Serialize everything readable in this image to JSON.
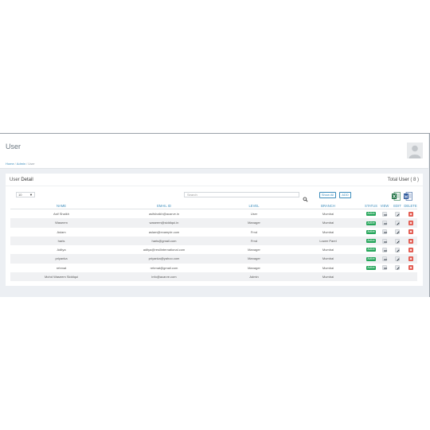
{
  "header": {
    "title": "User"
  },
  "breadcrumb": [
    "Home",
    "Admin",
    "User"
  ],
  "card": {
    "title_prefix": "User",
    "title_bold": "Detail",
    "total_prefix": "Total",
    "total_bold": "User",
    "total_count": "( 8 )"
  },
  "controls": {
    "page_size": "10",
    "search_placeholder": "Search",
    "show_all_label": "Show All",
    "add_label": "ADD"
  },
  "table": {
    "columns": [
      "NAME",
      "EMAIL ID",
      "LEVEL",
      "BRANCH",
      "STATUS",
      "VIEW",
      "EDIT",
      "DELETE"
    ],
    "rows": [
      {
        "name": "Asif Shaikh",
        "email": "asifshaikh@acarve.in",
        "level": "User",
        "branch": "Mumbai",
        "status": "Active",
        "actions": true
      },
      {
        "name": "Waseem",
        "email": "waseem@siddiqui.in",
        "level": "Manager",
        "branch": "Mumbai",
        "status": "Active",
        "actions": true
      },
      {
        "name": "Aslam",
        "email": "aslam@example.com",
        "level": "Frnd",
        "branch": "Mumbai",
        "status": "Active",
        "actions": true
      },
      {
        "name": "haris",
        "email": "haris@gmail.com",
        "level": "Frnd",
        "branch": "Lower Parel",
        "status": "Active",
        "actions": true
      },
      {
        "name": "Aditya",
        "email": "aditya@resilinternational.com",
        "level": "Manager",
        "branch": "Mumbai",
        "status": "Active",
        "actions": true
      },
      {
        "name": "priyanka",
        "email": "priyanka@yahoo.com",
        "level": "Manager",
        "branch": "Mumbai",
        "status": "Active",
        "actions": true
      },
      {
        "name": "rehmat",
        "email": "rehmat@gmail.com",
        "level": "Manager",
        "branch": "Mumbai",
        "status": "Active",
        "actions": true
      },
      {
        "name": "Mohd Waseem Siddiqui",
        "email": "info@acarve.com",
        "level": "Admin",
        "branch": "Mumbai",
        "status": "",
        "actions": false
      }
    ]
  },
  "icons": {
    "avatar": "user-avatar-icon",
    "search": "search-icon",
    "excel": "excel-icon",
    "word": "word-icon",
    "view": "eye-icon",
    "edit": "pencil-icon",
    "delete": "close-icon"
  },
  "colors": {
    "accent": "#3c8dbc",
    "active_badge": "#26a65b",
    "delete": "#e2574c",
    "excel": "#1f7244",
    "word": "#2b579a"
  }
}
